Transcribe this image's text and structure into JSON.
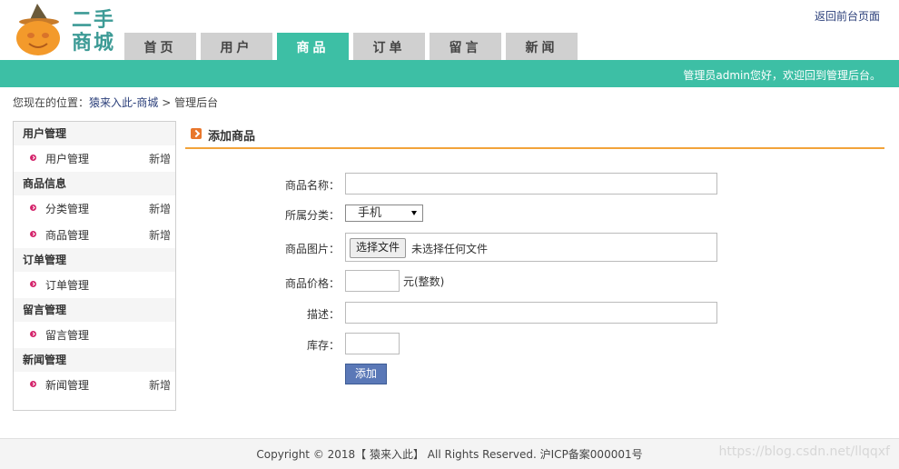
{
  "header": {
    "logo_text": "二手\n商城",
    "back_link": "返回前台页面",
    "welcome": "管理员admin您好，欢迎回到管理后台。"
  },
  "nav": [
    {
      "label": "首页",
      "active": false
    },
    {
      "label": "用户",
      "active": false
    },
    {
      "label": "商品",
      "active": true
    },
    {
      "label": "订单",
      "active": false
    },
    {
      "label": "留言",
      "active": false
    },
    {
      "label": "新闻",
      "active": false
    }
  ],
  "breadcrumb": {
    "prefix": "您现在的位置：",
    "site": "猿来入此-商城",
    "separator": ">",
    "current": "管理后台"
  },
  "sidebar": {
    "groups": [
      {
        "title": "用户管理",
        "items": [
          {
            "label": "用户管理",
            "extra": "新增"
          }
        ]
      },
      {
        "title": "商品信息",
        "items": [
          {
            "label": "分类管理",
            "extra": "新增"
          },
          {
            "label": "商品管理",
            "extra": "新增"
          }
        ]
      },
      {
        "title": "订单管理",
        "items": [
          {
            "label": "订单管理",
            "extra": ""
          }
        ]
      },
      {
        "title": "留言管理",
        "items": [
          {
            "label": "留言管理",
            "extra": ""
          }
        ]
      },
      {
        "title": "新闻管理",
        "items": [
          {
            "label": "新闻管理",
            "extra": "新增"
          }
        ]
      }
    ]
  },
  "main": {
    "title": "添加商品",
    "form": {
      "name_label": "商品名称：",
      "name_value": "",
      "category_label": "所属分类：",
      "category_value": "手机",
      "image_label": "商品图片：",
      "file_button": "选择文件",
      "file_status": "未选择任何文件",
      "price_label": "商品价格：",
      "price_value": "",
      "price_unit": "元(整数)",
      "desc_label": "描述：",
      "desc_value": "",
      "stock_label": "库存：",
      "stock_value": "",
      "submit": "添加"
    }
  },
  "footer": {
    "text": "Copyright © 2018【 猿来入此】 All Rights Reserved. 沪ICP备案000001号",
    "watermark": "https://blog.csdn.net/llqqxf"
  },
  "colors": {
    "accent": "#3dbfa5",
    "tab_inactive": "#d0d0d0",
    "title_underline": "#f2a33a",
    "button": "#5a78b7",
    "bullet": "#d4246b"
  }
}
